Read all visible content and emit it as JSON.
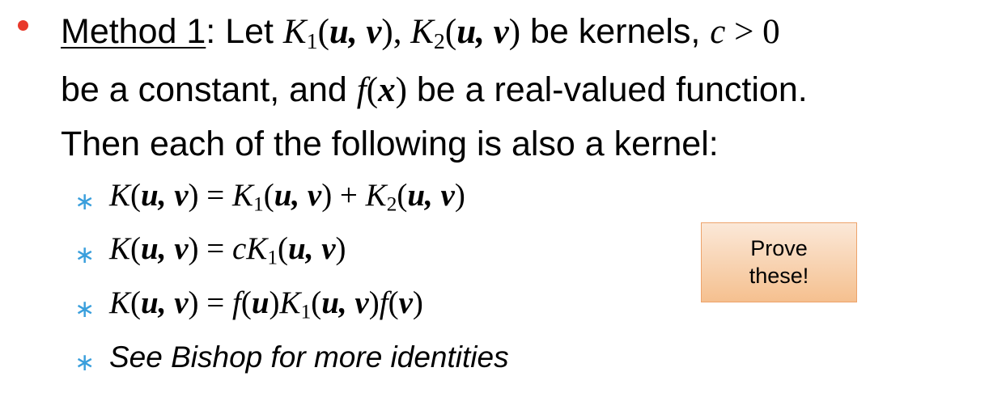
{
  "bullet_color": "#e8392b",
  "sub_bullet_color": "#3a9fdc",
  "main_bullet": {
    "lead": "Method 1",
    "lines": [
      [
        {
          "t": ": Let "
        },
        {
          "t": "K",
          "s": "i"
        },
        {
          "t": "1",
          "s": "sub"
        },
        {
          "t": "(",
          "s": "r"
        },
        {
          "t": "u, v",
          "s": "b"
        },
        {
          "t": "), ",
          "s": "r"
        },
        {
          "t": "K",
          "s": "i"
        },
        {
          "t": "2",
          "s": "sub"
        },
        {
          "t": "(",
          "s": "r"
        },
        {
          "t": "u, v",
          "s": "b"
        },
        {
          "t": ")",
          "s": "r"
        },
        {
          "t": " be kernels, "
        },
        {
          "t": "c",
          "s": "i"
        },
        {
          "t": " > 0",
          "s": "r"
        }
      ],
      [
        {
          "t": "be a constant, and "
        },
        {
          "t": "f",
          "s": "i"
        },
        {
          "t": "(",
          "s": "r"
        },
        {
          "t": "x",
          "s": "b"
        },
        {
          "t": ")",
          "s": "r"
        },
        {
          "t": " be a real-valued function."
        }
      ],
      [
        {
          "t": "Then each of the following is also a kernel:"
        }
      ]
    ]
  },
  "sub_bullets": [
    [
      {
        "t": "K",
        "s": "i"
      },
      {
        "t": "(",
        "s": "r"
      },
      {
        "t": "u, v",
        "s": "b"
      },
      {
        "t": ") = ",
        "s": "r"
      },
      {
        "t": "K",
        "s": "i"
      },
      {
        "t": "1",
        "s": "sub"
      },
      {
        "t": "(",
        "s": "r"
      },
      {
        "t": "u, v",
        "s": "b"
      },
      {
        "t": ") + ",
        "s": "r"
      },
      {
        "t": "K",
        "s": "i"
      },
      {
        "t": "2",
        "s": "sub"
      },
      {
        "t": "(",
        "s": "r"
      },
      {
        "t": "u, v",
        "s": "b"
      },
      {
        "t": ")",
        "s": "r"
      }
    ],
    [
      {
        "t": "K",
        "s": "i"
      },
      {
        "t": "(",
        "s": "r"
      },
      {
        "t": "u, v",
        "s": "b"
      },
      {
        "t": ") = ",
        "s": "r"
      },
      {
        "t": "cK",
        "s": "i"
      },
      {
        "t": "1",
        "s": "sub"
      },
      {
        "t": "(",
        "s": "r"
      },
      {
        "t": "u, v",
        "s": "b"
      },
      {
        "t": ")",
        "s": "r"
      }
    ],
    [
      {
        "t": "K",
        "s": "i"
      },
      {
        "t": "(",
        "s": "r"
      },
      {
        "t": "u, v",
        "s": "b"
      },
      {
        "t": ") = ",
        "s": "r"
      },
      {
        "t": "f",
        "s": "i"
      },
      {
        "t": "(",
        "s": "r"
      },
      {
        "t": "u",
        "s": "b"
      },
      {
        "t": ")",
        "s": "r"
      },
      {
        "t": "K",
        "s": "i"
      },
      {
        "t": "1",
        "s": "sub"
      },
      {
        "t": "(",
        "s": "r"
      },
      {
        "t": "u, v",
        "s": "b"
      },
      {
        "t": ")",
        "s": "r"
      },
      {
        "t": "f",
        "s": "i"
      },
      {
        "t": "(",
        "s": "r"
      },
      {
        "t": "v",
        "s": "b"
      },
      {
        "t": ")",
        "s": "r"
      }
    ],
    [
      {
        "t": "See Bishop for more identities",
        "s": "ital"
      }
    ]
  ],
  "callout": {
    "line1": "Prove",
    "line2": "these!"
  }
}
